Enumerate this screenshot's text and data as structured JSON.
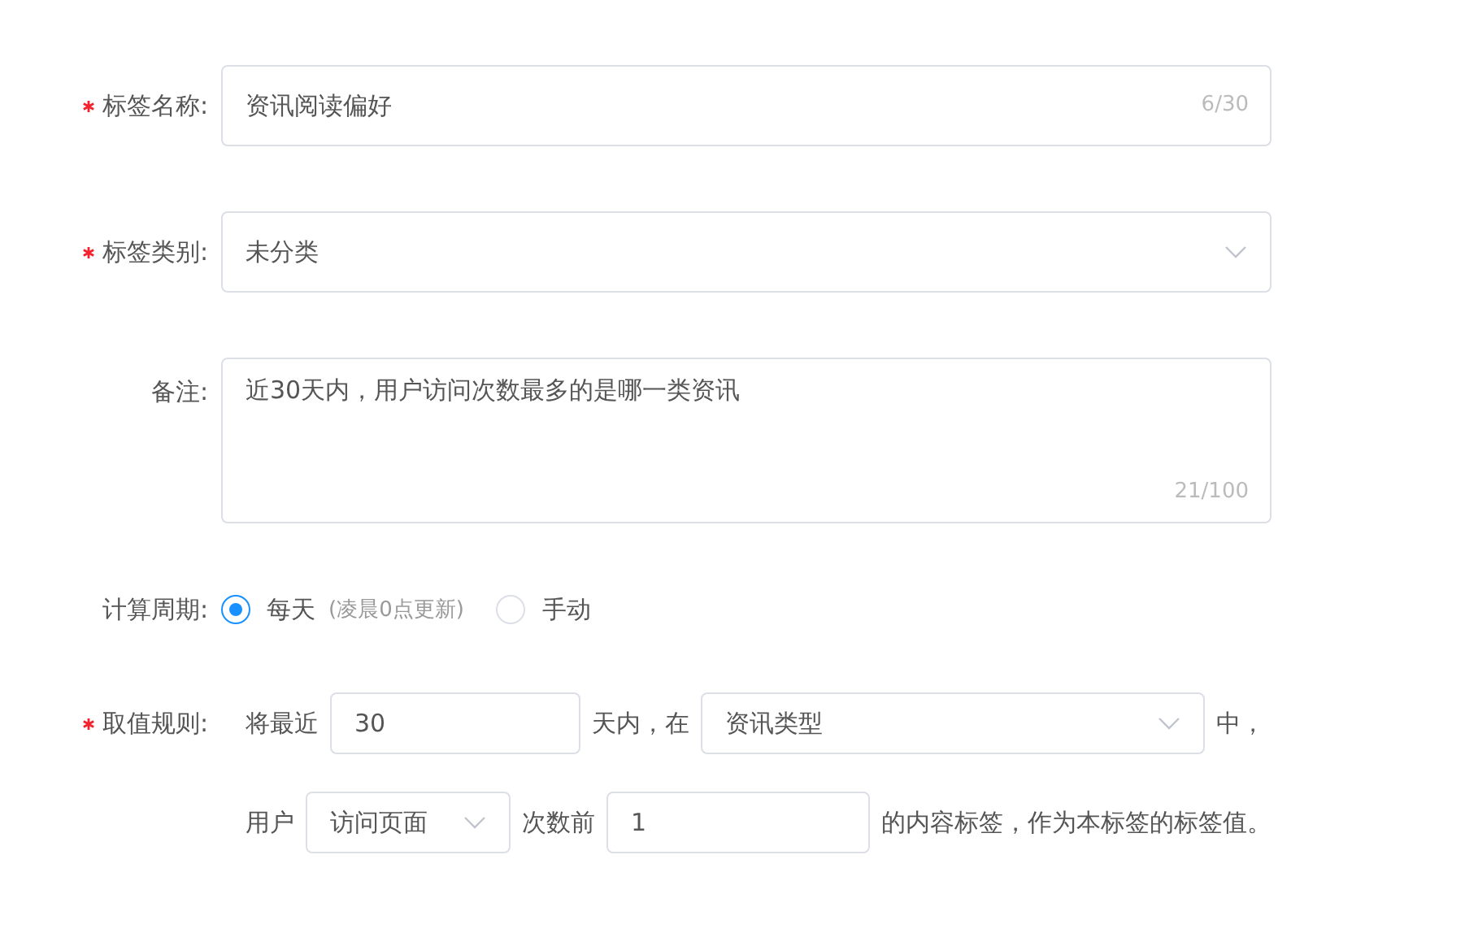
{
  "form": {
    "fields": [
      {
        "kind": "input",
        "label": "标签名称:",
        "required": true,
        "value": "资讯阅读偏好",
        "counter": "6/30"
      },
      {
        "kind": "select",
        "label": "标签类别:",
        "required": true,
        "value": "未分类"
      },
      {
        "kind": "textarea",
        "label": "备注:",
        "required": false,
        "value": "近30天内，用户访问次数最多的是哪一类资讯",
        "counter": "21/100"
      },
      {
        "kind": "radio",
        "label": "计算周期:",
        "required": false,
        "options": [
          {
            "label": "每天",
            "note": "(凌晨0点更新)",
            "selected": true
          },
          {
            "label": "手动",
            "selected": false
          }
        ]
      },
      {
        "kind": "rule",
        "label": "取值规则:",
        "required": true,
        "lines": [
          [
            {
              "kind": "text",
              "text": "将最近"
            },
            {
              "kind": "input",
              "value": "30"
            },
            {
              "kind": "text",
              "text": "天内，在"
            },
            {
              "kind": "select",
              "value": "资讯类型"
            },
            {
              "kind": "text",
              "text": "中，"
            }
          ],
          [
            {
              "kind": "text",
              "text": "用户"
            },
            {
              "kind": "select",
              "value": "访问页面"
            },
            {
              "kind": "text",
              "text": "次数前"
            },
            {
              "kind": "input",
              "value": "1"
            },
            {
              "kind": "text",
              "text": "的内容标签，作为本标签的标签值。"
            }
          ]
        ]
      }
    ]
  }
}
